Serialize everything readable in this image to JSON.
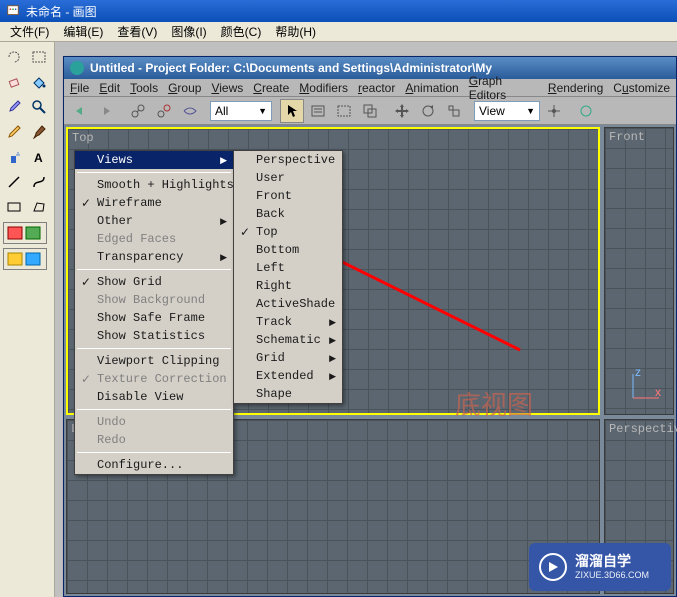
{
  "paint": {
    "title": "未命名 - 画图",
    "menu": [
      "文件(F)",
      "编辑(E)",
      "查看(V)",
      "图像(I)",
      "颜色(C)",
      "帮助(H)"
    ]
  },
  "max": {
    "title": "Untitled    -  Project Folder: C:\\Documents and Settings\\Administrator\\My",
    "menu": [
      {
        "label": "File",
        "u": "F"
      },
      {
        "label": "Edit",
        "u": "E"
      },
      {
        "label": "Tools",
        "u": "T"
      },
      {
        "label": "Group",
        "u": "G"
      },
      {
        "label": "Views",
        "u": "V"
      },
      {
        "label": "Create",
        "u": "C"
      },
      {
        "label": "Modifiers",
        "u": "M"
      },
      {
        "label": "reactor",
        "u": "r"
      },
      {
        "label": "Animation",
        "u": "A"
      },
      {
        "label": "Graph Editors",
        "u": "G"
      },
      {
        "label": "Rendering",
        "u": "R"
      },
      {
        "label": "Customize",
        "u": "u"
      }
    ],
    "combo_sel": "All",
    "combo_view": "View",
    "viewports": {
      "top_left": "Top",
      "top_right": "Front",
      "bot_left": "L",
      "bot_right": "Perspectiv"
    }
  },
  "ctx1": {
    "items": [
      {
        "label": "Views",
        "hl": true,
        "arrow": true
      },
      {
        "sep": true
      },
      {
        "label": "Smooth + Highlights"
      },
      {
        "label": "Wireframe",
        "checked": true
      },
      {
        "label": "Other",
        "arrow": true
      },
      {
        "label": "Edged Faces",
        "disabled": true
      },
      {
        "label": "Transparency",
        "arrow": true
      },
      {
        "sep": true
      },
      {
        "label": "Show Grid",
        "checked": true
      },
      {
        "label": "Show Background",
        "disabled": true
      },
      {
        "label": "Show Safe Frame"
      },
      {
        "label": "Show Statistics"
      },
      {
        "sep": true
      },
      {
        "label": "Viewport Clipping"
      },
      {
        "label": "Texture Correction",
        "checked": true,
        "disabled": true
      },
      {
        "label": "Disable View"
      },
      {
        "sep": true
      },
      {
        "label": "Undo",
        "disabled": true
      },
      {
        "label": "Redo",
        "disabled": true
      },
      {
        "sep": true
      },
      {
        "label": "Configure..."
      }
    ]
  },
  "ctx2": {
    "items": [
      {
        "label": "Perspective"
      },
      {
        "label": "User"
      },
      {
        "label": "Front"
      },
      {
        "label": "Back"
      },
      {
        "label": "Top",
        "checked": true
      },
      {
        "label": "Bottom"
      },
      {
        "label": "Left"
      },
      {
        "label": "Right"
      },
      {
        "label": "ActiveShade"
      },
      {
        "label": "Track",
        "arrow": true
      },
      {
        "label": "Schematic",
        "arrow": true
      },
      {
        "label": "Grid",
        "arrow": true
      },
      {
        "label": "Extended",
        "arrow": true
      },
      {
        "label": "Shape"
      }
    ]
  },
  "watermark": {
    "text": "底视图",
    "badge_big": "溜溜自学",
    "badge_small": "ZIXUE.3D66.COM"
  }
}
